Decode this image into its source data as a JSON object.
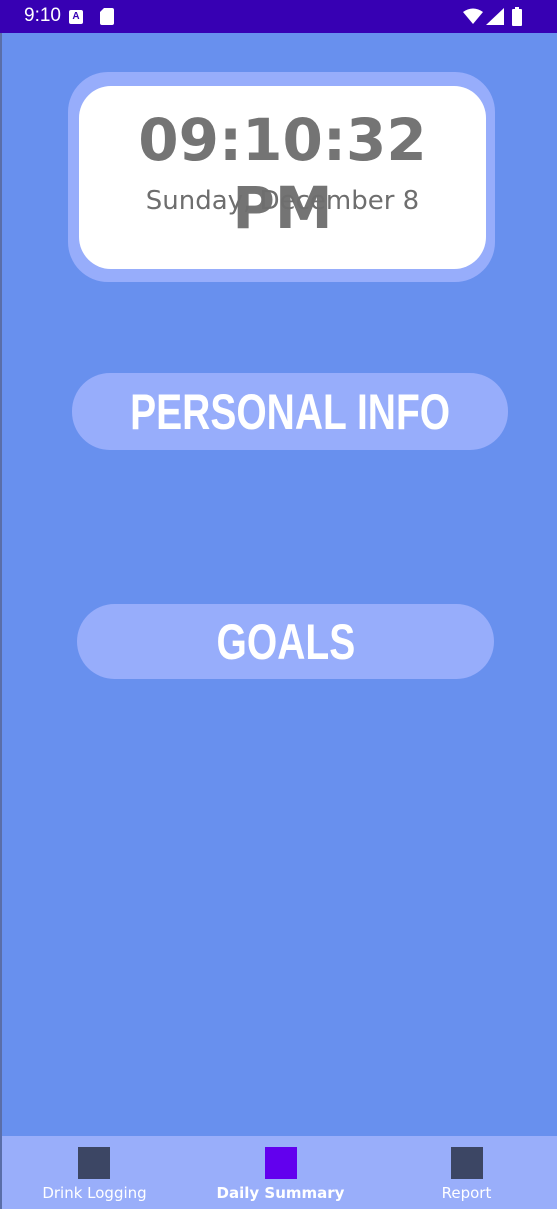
{
  "status_bar": {
    "time": "9:10",
    "notification_icon_letter": "A",
    "icons": [
      "a-notification-icon",
      "sd-card-icon",
      "wifi-icon",
      "signal-icon",
      "battery-icon"
    ]
  },
  "clock": {
    "time": "09:10:32 PM",
    "date": "Sunday, December 8"
  },
  "buttons": {
    "personal_info": "PERSONAL INFO",
    "goals": "GOALS"
  },
  "bottom_nav": {
    "items": [
      {
        "label": "Drink Logging",
        "active": false
      },
      {
        "label": "Daily Summary",
        "active": true
      },
      {
        "label": "Report",
        "active": false
      }
    ]
  },
  "colors": {
    "status_bar": "#3700b3",
    "background": "#6890ee",
    "accent": "#97adfb",
    "nav_active_icon": "#6200ee",
    "nav_inactive_icon": "#3c4664"
  }
}
